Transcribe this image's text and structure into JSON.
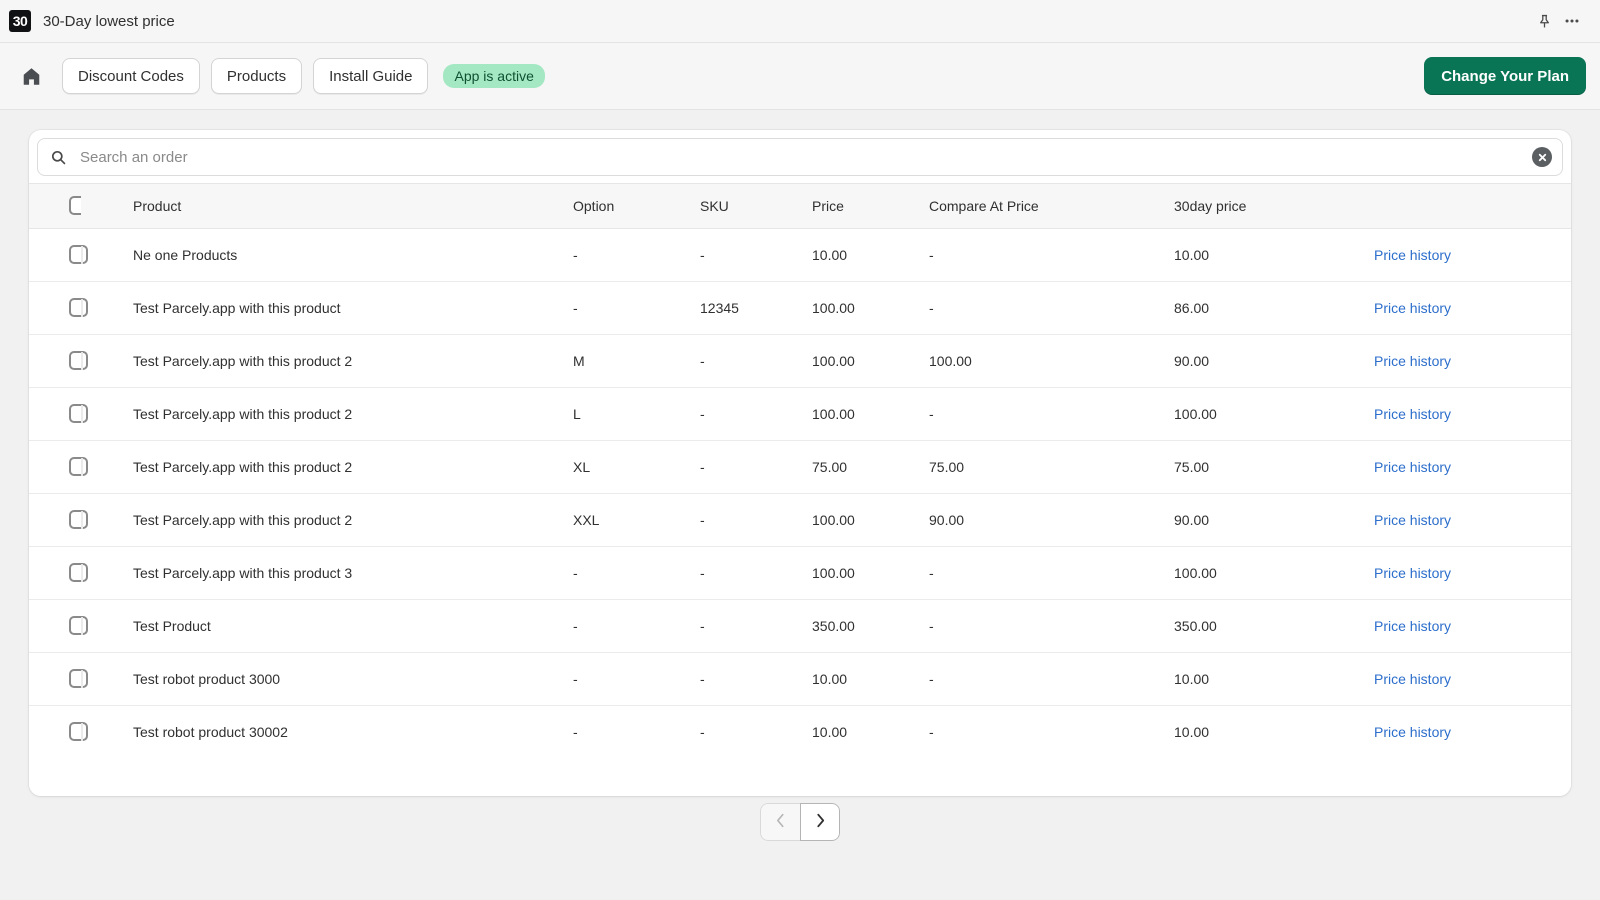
{
  "topbar": {
    "logo_text": "30",
    "title": "30-Day lowest price",
    "pin_icon": "pin-icon",
    "more_icon": "more-horizontal-icon"
  },
  "navbar": {
    "home_icon": "home-icon",
    "buttons": [
      {
        "label": "Discount Codes"
      },
      {
        "label": "Products"
      },
      {
        "label": "Install Guide"
      }
    ],
    "status_badge": "App is active",
    "primary_button": "Change Your Plan",
    "accent_color": "#0a7555",
    "badge_bg": "#a4e8c3",
    "badge_fg": "#0c5132"
  },
  "search": {
    "icon": "search-icon",
    "placeholder": "Search an order",
    "value": "",
    "clear_icon": "clear-circle-icon"
  },
  "table": {
    "columns": [
      "Product",
      "Option",
      "SKU",
      "Price",
      "Compare At Price",
      "30day price"
    ],
    "action_label": "Price history",
    "rows": [
      {
        "product": "Ne one Products",
        "option": "-",
        "sku": "-",
        "price": "10.00",
        "compare_at": "-",
        "thirty_day": "10.00",
        "action": "Price history"
      },
      {
        "product": "Test Parcely.app with this product",
        "option": "-",
        "sku": "12345",
        "price": "100.00",
        "compare_at": "-",
        "thirty_day": "86.00",
        "action": "Price history"
      },
      {
        "product": "Test Parcely.app with this product 2",
        "option": "M",
        "sku": "-",
        "price": "100.00",
        "compare_at": "100.00",
        "thirty_day": "90.00",
        "action": "Price history"
      },
      {
        "product": "Test Parcely.app with this product 2",
        "option": "L",
        "sku": "-",
        "price": "100.00",
        "compare_at": "-",
        "thirty_day": "100.00",
        "action": "Price history"
      },
      {
        "product": "Test Parcely.app with this product 2",
        "option": "XL",
        "sku": "-",
        "price": "75.00",
        "compare_at": "75.00",
        "thirty_day": "75.00",
        "action": "Price history"
      },
      {
        "product": "Test Parcely.app with this product 2",
        "option": "XXL",
        "sku": "-",
        "price": "100.00",
        "compare_at": "90.00",
        "thirty_day": "90.00",
        "action": "Price history"
      },
      {
        "product": "Test Parcely.app with this product 3",
        "option": "-",
        "sku": "-",
        "price": "100.00",
        "compare_at": "-",
        "thirty_day": "100.00",
        "action": "Price history"
      },
      {
        "product": "Test Product",
        "option": "-",
        "sku": "-",
        "price": "350.00",
        "compare_at": "-",
        "thirty_day": "350.00",
        "action": "Price history"
      },
      {
        "product": "Test robot product 3000",
        "option": "-",
        "sku": "-",
        "price": "10.00",
        "compare_at": "-",
        "thirty_day": "10.00",
        "action": "Price history"
      },
      {
        "product": "Test robot product 30002",
        "option": "-",
        "sku": "-",
        "price": "10.00",
        "compare_at": "-",
        "thirty_day": "10.00",
        "action": "Price history"
      }
    ]
  },
  "pagination": {
    "prev_icon": "chevron-left-icon",
    "next_icon": "chevron-right-icon",
    "prev_enabled": false,
    "next_enabled": true
  }
}
